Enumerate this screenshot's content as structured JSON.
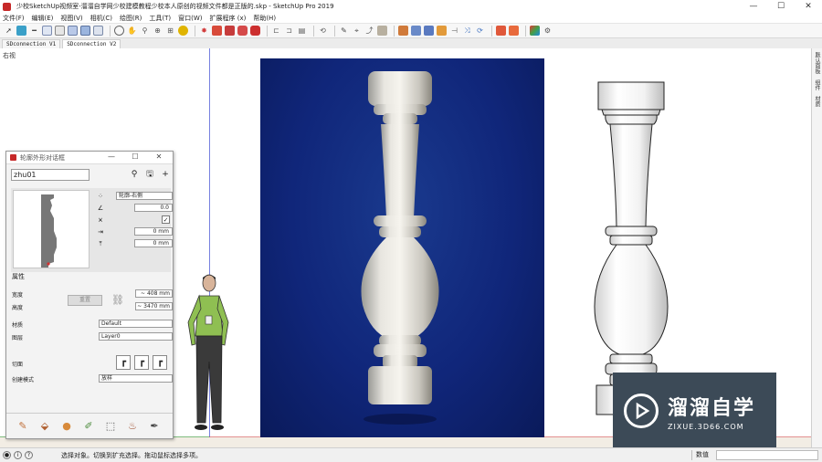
{
  "window": {
    "title": "少校SketchUp视频室-溜溜自学网少校建模教程少校本人原创的视频文件都是正版的.skp - SketchUp Pro 2019",
    "controls": [
      "—",
      "☐",
      "✕"
    ]
  },
  "menu": [
    "文件(F)",
    "编辑(E)",
    "视图(V)",
    "相机(C)",
    "绘图(R)",
    "工具(T)",
    "窗口(W)",
    "扩展程序 (x)",
    "帮助(H)"
  ],
  "scene_tabs": [
    "SDconnection V1",
    "SDconnection V2"
  ],
  "viewport": {
    "label": "右视"
  },
  "tray_tabs": [
    "默认面板",
    "组件",
    "材质"
  ],
  "watermark": {
    "title": "溜溜自学",
    "url": "ZIXUE.3D66.COM"
  },
  "status": {
    "text": "选择对象。切换到扩充选择。拖动鼠标选择多项。",
    "measurement_label": "数值"
  },
  "dialog": {
    "title": "轮廓外形对话框",
    "name_value": "zhu01",
    "params": {
      "profile_type": "轮廓-右侧",
      "angle": "0.0",
      "checked": "✓",
      "offset_x": "0 mm",
      "offset_y": "0 mm"
    },
    "properties_label": "属性",
    "width_label": "宽度",
    "height_label": "高度",
    "width_value": "~ 408 mm",
    "height_value": "~ 3470 mm",
    "reset_label": "重置",
    "material_label": "材质",
    "material_value": "Default",
    "layer_label": "图层",
    "layer_value": "Layer0",
    "cut_label": "切面",
    "mode_label": "创建模式",
    "mode_value": "放样"
  }
}
